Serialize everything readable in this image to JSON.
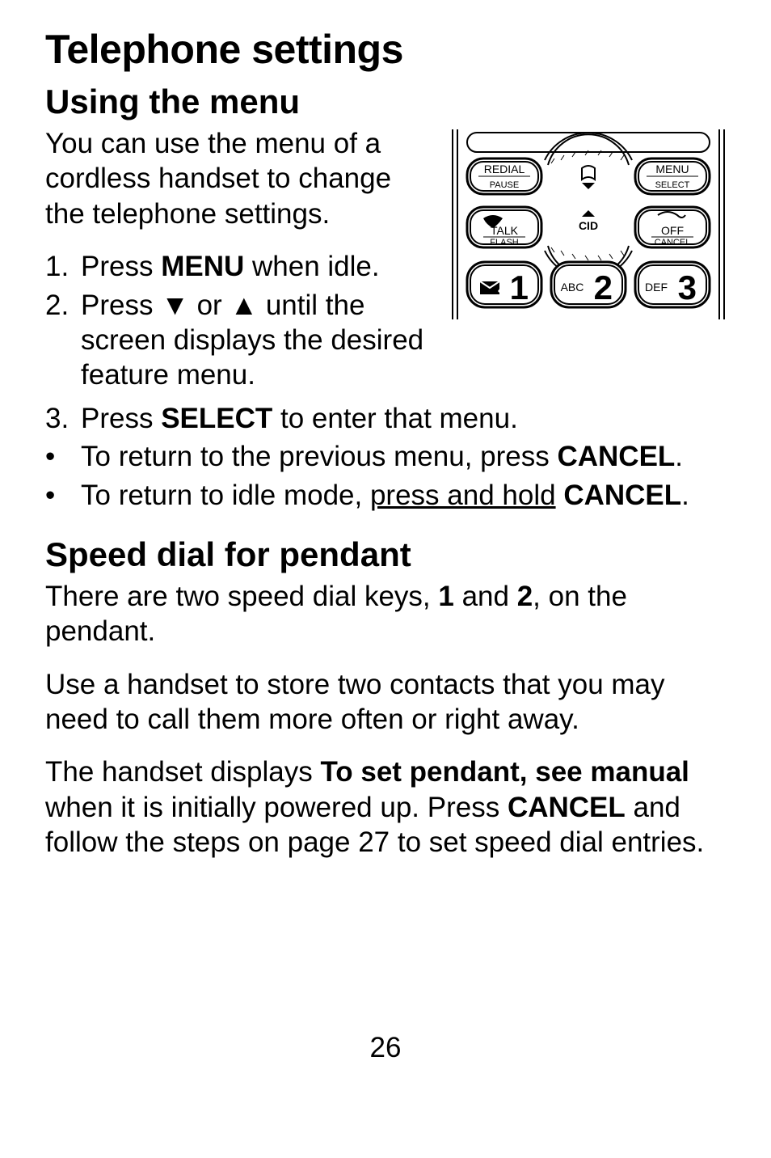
{
  "title": "Telephone settings",
  "section1": {
    "heading": "Using the menu",
    "intro": "You can use the menu of a cordless handset to change the telephone settings.",
    "step1_pre": "Press ",
    "step1_b": "MENU",
    "step1_post": " when idle.",
    "step2_pre": "Press ",
    "step2_mid": " or ",
    "step2_post": " until the screen displays the desired feature menu.",
    "step3_pre": "Press ",
    "step3_b": "SELECT",
    "step3_post": " to enter that menu.",
    "bullet1_pre": "To return to the previous menu, press ",
    "bullet1_b": "CANCEL",
    "bullet1_post": ".",
    "bullet2_pre": "To return to idle mode, ",
    "bullet2_u": "press and hold",
    "bullet2_sp": " ",
    "bullet2_b": "CANCEL",
    "bullet2_post": "."
  },
  "section2": {
    "heading": "Speed dial for pendant",
    "p1_pre": "There are two speed dial keys, ",
    "p1_b1": "1",
    "p1_mid": " and ",
    "p1_b2": "2",
    "p1_post": ", on the pendant.",
    "p2": "Use a handset to store two contacts that you may need to call them more often or right away.",
    "p3_pre": "The handset displays ",
    "p3_b1": "To set pendant, see manual",
    "p3_mid": " when it is initially powered up. Press ",
    "p3_b2": "CANCEL",
    "p3_post": " and follow the steps on page 27 to set speed dial entries."
  },
  "keypad": {
    "redial": "REDIAL",
    "pause": "PAUSE",
    "menu": "MENU",
    "select": "SELECT",
    "talk": "TALK",
    "flash": "FLASH",
    "cid": "CID",
    "off": "OFF",
    "cancel": "CANCEL",
    "key1_small": "",
    "key1_big": "1",
    "key2_small": "ABC",
    "key2_big": "2",
    "key3_small": "DEF",
    "key3_big": "3"
  },
  "page_number": "26",
  "icons": {
    "down_triangle": "▼",
    "up_triangle": "▲"
  }
}
